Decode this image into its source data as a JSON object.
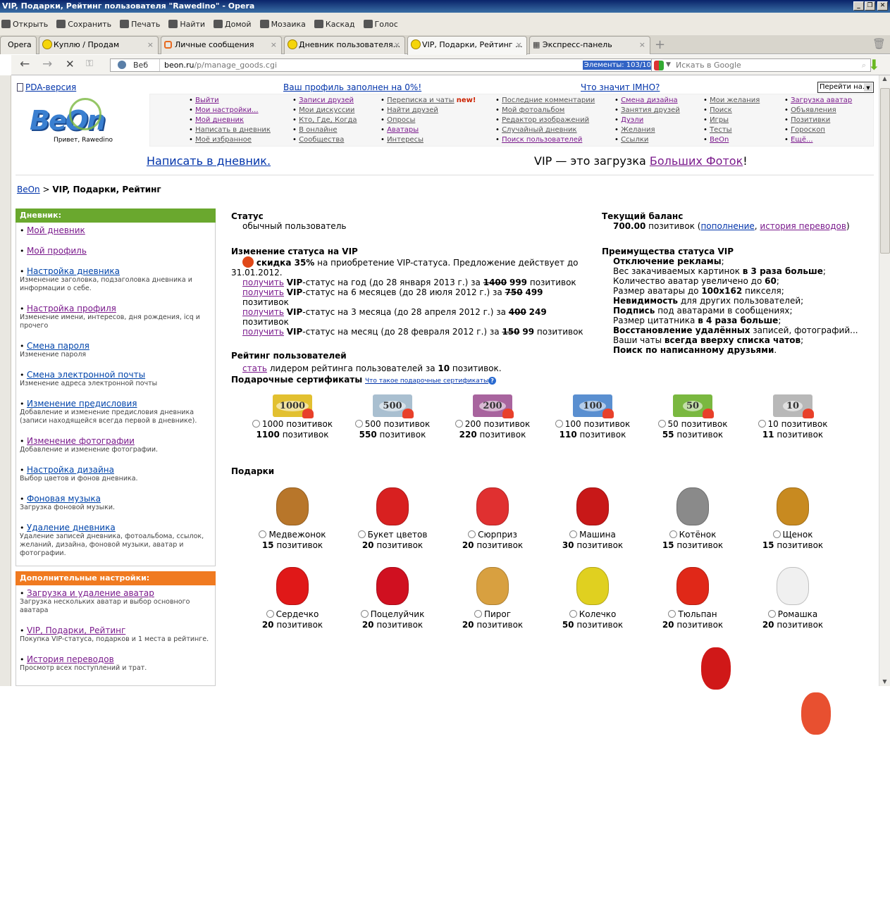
{
  "window": {
    "title": "VIP, Подарки, Рейтинг пользователя \"Rawedino\" - Opera"
  },
  "menubar": [
    "Открыть",
    "Сохранить",
    "Печать",
    "Найти",
    "Домой",
    "Мозаика",
    "Каскад",
    "Голос"
  ],
  "tabs": {
    "opera": "Opera",
    "items": [
      "Куплю / Продам",
      "Личные сообщения",
      "Дневник пользователя...",
      "VIP, Подарки, Рейтинг ...",
      "Экспресс-панель"
    ]
  },
  "address": {
    "web": "Веб",
    "host": "beon.ru",
    "path": "/p/manage_goods.cgi",
    "elements": "Элементы:   103/10",
    "search_placeholder": "Искать в Google"
  },
  "header": {
    "pda": "PDA-версия",
    "profile_fill": "Ваш профиль заполнен на 0%!",
    "imho": "Что значит IMHO?",
    "goto": "Перейти на...",
    "greeting": "Привет, Rawedino",
    "logo": "BeOn",
    "write": "Написать в дневник.",
    "vip_promo": "VIP — это загрузка ",
    "vip_promo_link": "Больших Фоток",
    "vip_promo_end": "!"
  },
  "nav": [
    [
      "Выйти",
      "Мои настройки...",
      "Мой дневник",
      "Написать в дневник",
      "Моё избранное"
    ],
    [
      "Записи друзей",
      "Мои дискуссии",
      "Кто, Где, Когда",
      "В онлайне",
      "Сообщества"
    ],
    [
      "Переписка и чаты",
      "Найти друзей",
      "Опросы",
      "Аватары",
      "Интересы"
    ],
    [
      "Последние комментарии",
      "Мой фотоальбом",
      "Редактор изображений",
      "Случайный дневник",
      "Поиск пользователей"
    ],
    [
      "Смена дизайна",
      "Занятия друзей",
      "Дуэли",
      "Желания",
      "Ссылки"
    ],
    [
      "Мои желания",
      "Поиск",
      "Игры",
      "Тесты",
      "BeOn"
    ],
    [
      "Загрузка аватар",
      "Объявления",
      "Позитивки",
      "Гороскоп",
      "Ещё..."
    ]
  ],
  "nav_new": "new!",
  "breadcrumb": {
    "root": "BeOn",
    "sep": " > ",
    "current": "VIP, Подарки, Рейтинг"
  },
  "sidebar": {
    "diary_title": "Дневник:",
    "diary": [
      {
        "label": "Мой дневник",
        "desc": ""
      },
      {
        "label": "Мой профиль",
        "desc": ""
      },
      {
        "label": "Настройка дневника",
        "desc": "Изменение заголовка, подзаголовка дневника и информации о себе."
      },
      {
        "label": "Настройка профиля",
        "desc": "Изменение имени, интересов, дня рождения, icq и прочего"
      },
      {
        "label": "Смена пароля",
        "desc": "Изменение пароля"
      },
      {
        "label": "Смена электронной почты",
        "desc": "Изменение адреса электронной почты"
      },
      {
        "label": "Изменение предисловия",
        "desc": "Добавление и изменение предисловия дневника (записи находящейся всегда первой в дневнике)."
      },
      {
        "label": "Изменение фотографии",
        "desc": "Добавление и изменение фотографии."
      },
      {
        "label": "Настройка дизайна",
        "desc": "Выбор цветов и фонов дневника."
      },
      {
        "label": "Фоновая музыка",
        "desc": "Загрузка фоновой музыки."
      },
      {
        "label": "Удаление дневника",
        "desc": "Удаление записей дневника, фотоальбома, ссылок, желаний, дизайна, фоновой музыки, аватар и фотографии."
      }
    ],
    "extra_title": "Дополнительные настройки:",
    "extra": [
      {
        "label": "Загрузка и удаление аватар",
        "desc": "Загрузка нескольких аватар и выбор основного аватара"
      },
      {
        "label": "VIP, Подарки, Рейтинг",
        "desc": "Покупка VIP-статуса, подарков и 1 места в рейтинге."
      },
      {
        "label": "История переводов",
        "desc": "Просмотр всех поступлений и трат."
      }
    ]
  },
  "status": {
    "title": "Статус",
    "value": "обычный пользователь"
  },
  "balance": {
    "title": "Текущий баланс",
    "amount": "700.00",
    "unit": " позитивок (",
    "topup": "пополнение",
    "history": "история переводов",
    "close": ")"
  },
  "vip_change": {
    "title": "Изменение статуса на VIP",
    "discount_bold": "скидка 35%",
    "discount_text": " на приобретение VIP-статуса. Предложение действует до 31.01.2012.",
    "options": [
      {
        "link": "получить",
        "text": "-статус на год (до 28 января 2013 г.) за ",
        "old": "1400",
        "new": "999"
      },
      {
        "link": "получить",
        "text": "-статус на 6 месяцев (до 28 июля 2012 г.) за ",
        "old": "750",
        "new": "499"
      },
      {
        "link": "получить",
        "text": "-статус на 3 месяца (до 28 апреля 2012 г.) за ",
        "old": "400",
        "new": "249"
      },
      {
        "link": "получить",
        "text": "-статус на месяц (до 28 февраля 2012 г.) за ",
        "old": "150",
        "new": "99"
      }
    ],
    "vip": "VIP",
    "unit": " позитивок"
  },
  "rating": {
    "title": "Рейтинг пользователей",
    "link": "стать",
    "text": " лидером рейтинга пользователей за ",
    "amount": "10",
    "unit": " позитивок."
  },
  "vip_benefits": {
    "title": "Преимущества статуса VIP",
    "items": [
      [
        "",
        "Отключение рекламы",
        ";"
      ],
      [
        "Вес закачиваемых картинок ",
        "в 3 раза больше",
        ";"
      ],
      [
        "Количество аватар увеличено до ",
        "60",
        ";"
      ],
      [
        "Размер аватары до ",
        "100x162",
        " пикселя;"
      ],
      [
        "",
        "Невидимость",
        " для других пользователей;"
      ],
      [
        "",
        "Подпись",
        " под аватарами в сообщениях;"
      ],
      [
        "Размер цитатника ",
        "в 4 раза больше",
        ";"
      ],
      [
        "",
        "Восстановление удалённых",
        " записей, фотографий..."
      ],
      [
        "Ваши чаты ",
        "всегда вверху списка чатов",
        ";"
      ],
      [
        "",
        "Поиск по написанному друзьями",
        "."
      ]
    ]
  },
  "certificates": {
    "title": "Подарочные сертификаты",
    "help": "Что такое подарочные сертификаты",
    "items": [
      {
        "face": "1000",
        "label": "1000 позитивок",
        "price": "1100",
        "color": "#e2c030"
      },
      {
        "face": "500",
        "label": "500 позитивок",
        "price": "550",
        "color": "#a9bfd0"
      },
      {
        "face": "200",
        "label": "200 позитивок",
        "price": "220",
        "color": "#a8649e"
      },
      {
        "face": "100",
        "label": "100 позитивок",
        "price": "110",
        "color": "#5a8fd0"
      },
      {
        "face": "50",
        "label": "50 позитивок",
        "price": "55",
        "color": "#7ab840"
      },
      {
        "face": "10",
        "label": "10 позитивок",
        "price": "11",
        "color": "#b8b8b8"
      }
    ]
  },
  "gifts": {
    "title": "Подарки",
    "unit": " позитивок",
    "items": [
      {
        "name": "Медвежонок",
        "price": "15",
        "color": "#b8762a"
      },
      {
        "name": "Букет цветов",
        "price": "20",
        "color": "#d82020"
      },
      {
        "name": "Сюрприз",
        "price": "20",
        "color": "#e03030"
      },
      {
        "name": "Машина",
        "price": "30",
        "color": "#c81818"
      },
      {
        "name": "Котёнок",
        "price": "15",
        "color": "#8a8a8a"
      },
      {
        "name": "Щенок",
        "price": "15",
        "color": "#c88a20"
      },
      {
        "name": "Сердечко",
        "price": "20",
        "color": "#e01818"
      },
      {
        "name": "Поцелуйчик",
        "price": "20",
        "color": "#d01020"
      },
      {
        "name": "Пирог",
        "price": "20",
        "color": "#d8a040"
      },
      {
        "name": "Колечко",
        "price": "50",
        "color": "#e0d020"
      },
      {
        "name": "Тюльпан",
        "price": "20",
        "color": "#e02818"
      },
      {
        "name": "Ромашка",
        "price": "20",
        "color": "#f0f0f0"
      }
    ],
    "row3_colors": [
      "#d01818",
      "#e85030",
      "#f0d030",
      "#9090e0",
      "#d8b020",
      "#333333"
    ]
  }
}
